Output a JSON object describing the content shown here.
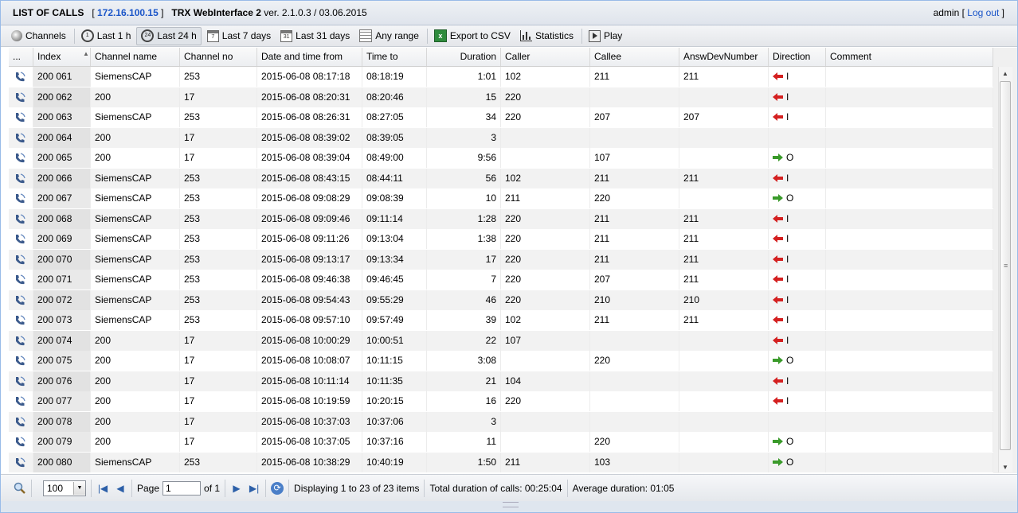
{
  "title": {
    "list_label": "LIST OF CALLS",
    "ip": "172.16.100.15",
    "app_name": "TRX WebInterface 2",
    "version": "ver. 2.1.0.3 / 03.06.2015",
    "user": "admin",
    "logout": "Log out"
  },
  "toolbar": {
    "channels": "Channels",
    "last1h": "Last 1 h",
    "last24h": "Last 24 h",
    "last7d": "Last 7 days",
    "last31d": "Last 31 days",
    "any_range": "Any range",
    "export_csv": "Export to CSV",
    "statistics": "Statistics",
    "play": "Play",
    "last1h_icon_text": "1",
    "last24h_icon_text": "24",
    "last7d_icon_text": "7",
    "last31d_icon_text": "31",
    "active": "last24h"
  },
  "columns": {
    "menu": "...",
    "index": "Index",
    "channel_name": "Channel name",
    "channel_no": "Channel no",
    "date_from": "Date and time from",
    "time_to": "Time to",
    "duration": "Duration",
    "caller": "Caller",
    "callee": "Callee",
    "answ_dev": "AnswDevNumber",
    "direction": "Direction",
    "comment": "Comment"
  },
  "rows": [
    {
      "index": "200 061",
      "channel_name": "SiemensCAP",
      "channel_no": "253",
      "date_from": "2015-06-08 08:17:18",
      "time_to": "08:18:19",
      "duration": "1:01",
      "caller": "102",
      "callee": "211",
      "answ_dev": "211",
      "direction": "I"
    },
    {
      "index": "200 062",
      "channel_name": "200",
      "channel_no": "17",
      "date_from": "2015-06-08 08:20:31",
      "time_to": "08:20:46",
      "duration": "15",
      "caller": "220",
      "callee": "",
      "answ_dev": "",
      "direction": "I"
    },
    {
      "index": "200 063",
      "channel_name": "SiemensCAP",
      "channel_no": "253",
      "date_from": "2015-06-08 08:26:31",
      "time_to": "08:27:05",
      "duration": "34",
      "caller": "220",
      "callee": "207",
      "answ_dev": "207",
      "direction": "I"
    },
    {
      "index": "200 064",
      "channel_name": "200",
      "channel_no": "17",
      "date_from": "2015-06-08 08:39:02",
      "time_to": "08:39:05",
      "duration": "3",
      "caller": "",
      "callee": "",
      "answ_dev": "",
      "direction": ""
    },
    {
      "index": "200 065",
      "channel_name": "200",
      "channel_no": "17",
      "date_from": "2015-06-08 08:39:04",
      "time_to": "08:49:00",
      "duration": "9:56",
      "caller": "",
      "callee": "107",
      "answ_dev": "",
      "direction": "O"
    },
    {
      "index": "200 066",
      "channel_name": "SiemensCAP",
      "channel_no": "253",
      "date_from": "2015-06-08 08:43:15",
      "time_to": "08:44:11",
      "duration": "56",
      "caller": "102",
      "callee": "211",
      "answ_dev": "211",
      "direction": "I"
    },
    {
      "index": "200 067",
      "channel_name": "SiemensCAP",
      "channel_no": "253",
      "date_from": "2015-06-08 09:08:29",
      "time_to": "09:08:39",
      "duration": "10",
      "caller": "211",
      "callee": "220",
      "answ_dev": "",
      "direction": "O"
    },
    {
      "index": "200 068",
      "channel_name": "SiemensCAP",
      "channel_no": "253",
      "date_from": "2015-06-08 09:09:46",
      "time_to": "09:11:14",
      "duration": "1:28",
      "caller": "220",
      "callee": "211",
      "answ_dev": "211",
      "direction": "I"
    },
    {
      "index": "200 069",
      "channel_name": "SiemensCAP",
      "channel_no": "253",
      "date_from": "2015-06-08 09:11:26",
      "time_to": "09:13:04",
      "duration": "1:38",
      "caller": "220",
      "callee": "211",
      "answ_dev": "211",
      "direction": "I"
    },
    {
      "index": "200 070",
      "channel_name": "SiemensCAP",
      "channel_no": "253",
      "date_from": "2015-06-08 09:13:17",
      "time_to": "09:13:34",
      "duration": "17",
      "caller": "220",
      "callee": "211",
      "answ_dev": "211",
      "direction": "I"
    },
    {
      "index": "200 071",
      "channel_name": "SiemensCAP",
      "channel_no": "253",
      "date_from": "2015-06-08 09:46:38",
      "time_to": "09:46:45",
      "duration": "7",
      "caller": "220",
      "callee": "207",
      "answ_dev": "211",
      "direction": "I"
    },
    {
      "index": "200 072",
      "channel_name": "SiemensCAP",
      "channel_no": "253",
      "date_from": "2015-06-08 09:54:43",
      "time_to": "09:55:29",
      "duration": "46",
      "caller": "220",
      "callee": "210",
      "answ_dev": "210",
      "direction": "I"
    },
    {
      "index": "200 073",
      "channel_name": "SiemensCAP",
      "channel_no": "253",
      "date_from": "2015-06-08 09:57:10",
      "time_to": "09:57:49",
      "duration": "39",
      "caller": "102",
      "callee": "211",
      "answ_dev": "211",
      "direction": "I"
    },
    {
      "index": "200 074",
      "channel_name": "200",
      "channel_no": "17",
      "date_from": "2015-06-08 10:00:29",
      "time_to": "10:00:51",
      "duration": "22",
      "caller": "107",
      "callee": "",
      "answ_dev": "",
      "direction": "I"
    },
    {
      "index": "200 075",
      "channel_name": "200",
      "channel_no": "17",
      "date_from": "2015-06-08 10:08:07",
      "time_to": "10:11:15",
      "duration": "3:08",
      "caller": "",
      "callee": "220",
      "answ_dev": "",
      "direction": "O"
    },
    {
      "index": "200 076",
      "channel_name": "200",
      "channel_no": "17",
      "date_from": "2015-06-08 10:11:14",
      "time_to": "10:11:35",
      "duration": "21",
      "caller": "104",
      "callee": "",
      "answ_dev": "",
      "direction": "I"
    },
    {
      "index": "200 077",
      "channel_name": "200",
      "channel_no": "17",
      "date_from": "2015-06-08 10:19:59",
      "time_to": "10:20:15",
      "duration": "16",
      "caller": "220",
      "callee": "",
      "answ_dev": "",
      "direction": "I"
    },
    {
      "index": "200 078",
      "channel_name": "200",
      "channel_no": "17",
      "date_from": "2015-06-08 10:37:03",
      "time_to": "10:37:06",
      "duration": "3",
      "caller": "",
      "callee": "",
      "answ_dev": "",
      "direction": ""
    },
    {
      "index": "200 079",
      "channel_name": "200",
      "channel_no": "17",
      "date_from": "2015-06-08 10:37:05",
      "time_to": "10:37:16",
      "duration": "11",
      "caller": "",
      "callee": "220",
      "answ_dev": "",
      "direction": "O"
    },
    {
      "index": "200 080",
      "channel_name": "SiemensCAP",
      "channel_no": "253",
      "date_from": "2015-06-08 10:38:29",
      "time_to": "10:40:19",
      "duration": "1:50",
      "caller": "211",
      "callee": "103",
      "answ_dev": "",
      "direction": "O"
    }
  ],
  "pager": {
    "page_size": "100",
    "page_label": "Page",
    "page_value": "1",
    "of_label": "of 1",
    "displaying": "Displaying 1 to 23 of 23 items",
    "total_duration": "Total duration of calls: 00:25:04",
    "avg_duration": "Average duration: 01:05"
  },
  "colors": {
    "incoming": "#d42020",
    "outgoing": "#3a9a2a",
    "link": "#1a55c8"
  }
}
